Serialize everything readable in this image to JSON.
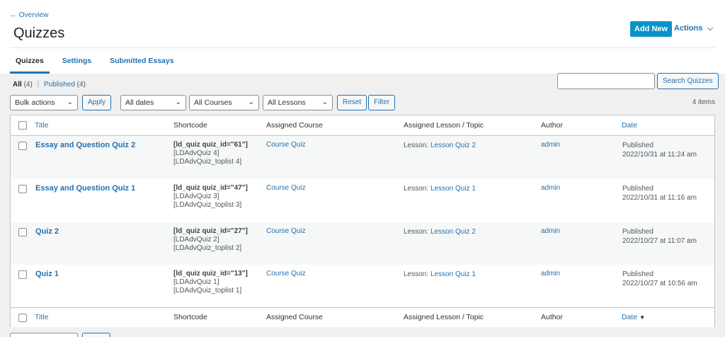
{
  "header": {
    "back_link": "← Overview",
    "title": "Quizzes",
    "add_new": "Add New",
    "actions": "Actions",
    "actions_chevron": "⌵"
  },
  "tabs": [
    {
      "label": "Quizzes",
      "active": true
    },
    {
      "label": "Settings",
      "active": false
    },
    {
      "label": "Submitted Essays",
      "active": false
    }
  ],
  "filters": {
    "all_label": "All",
    "all_count": "(4)",
    "published_label": "Published",
    "published_count": "(4)",
    "separator": "|"
  },
  "search": {
    "placeholder": "",
    "button": "Search Quizzes"
  },
  "toolbar": {
    "bulk_actions": "Bulk actions",
    "apply": "Apply",
    "dates": "All dates",
    "courses": "All Courses",
    "lessons": "All Lessons",
    "reset": "Reset",
    "filter": "Filter",
    "items_count": "4 items",
    "chevron": "⌄"
  },
  "table": {
    "columns": [
      "Title",
      "Shortcode",
      "Assigned Course",
      "Assigned Lesson / Topic",
      "Author",
      "Date"
    ],
    "lesson_prefix": "Lesson:",
    "sort_icon": "▼",
    "rows": [
      {
        "title": "Essay and Question Quiz 2",
        "shortcode": [
          "[ld_quiz quiz_id=\"61\"]",
          "[LDAdvQuiz 4]",
          "[LDAdvQuiz_toplist 4]"
        ],
        "course": "Course Quiz",
        "lesson": "Lesson Quiz 2",
        "author": "admin",
        "status": "Published",
        "date": "2022/10/31 at 11:24 am"
      },
      {
        "title": "Essay and Question Quiz 1",
        "shortcode": [
          "[ld_quiz quiz_id=\"47\"]",
          "[LDAdvQuiz 3]",
          "[LDAdvQuiz_toplist 3]"
        ],
        "course": "Course Quiz",
        "lesson": "Lesson Quiz 1",
        "author": "admin",
        "status": "Published",
        "date": "2022/10/31 at 11:16 am"
      },
      {
        "title": "Quiz 2",
        "shortcode": [
          "[ld_quiz quiz_id=\"27\"]",
          "[LDAdvQuiz 2]",
          "[LDAdvQuiz_toplist 2]"
        ],
        "course": "Course Quiz",
        "lesson": "Lesson Quiz 2",
        "author": "admin",
        "status": "Published",
        "date": "2022/10/27 at 11:07 am"
      },
      {
        "title": "Quiz 1",
        "shortcode": [
          "[ld_quiz quiz_id=\"13\"]",
          "[LDAdvQuiz 1]",
          "[LDAdvQuiz_toplist 1]"
        ],
        "course": "Course Quiz",
        "lesson": "Lesson Quiz 1",
        "author": "admin",
        "status": "Published",
        "date": "2022/10/27 at 10:56 am"
      }
    ]
  },
  "colors": {
    "accent": "#2271b1",
    "primary_button": "#0a93c7",
    "background": "#f0f0f1"
  }
}
